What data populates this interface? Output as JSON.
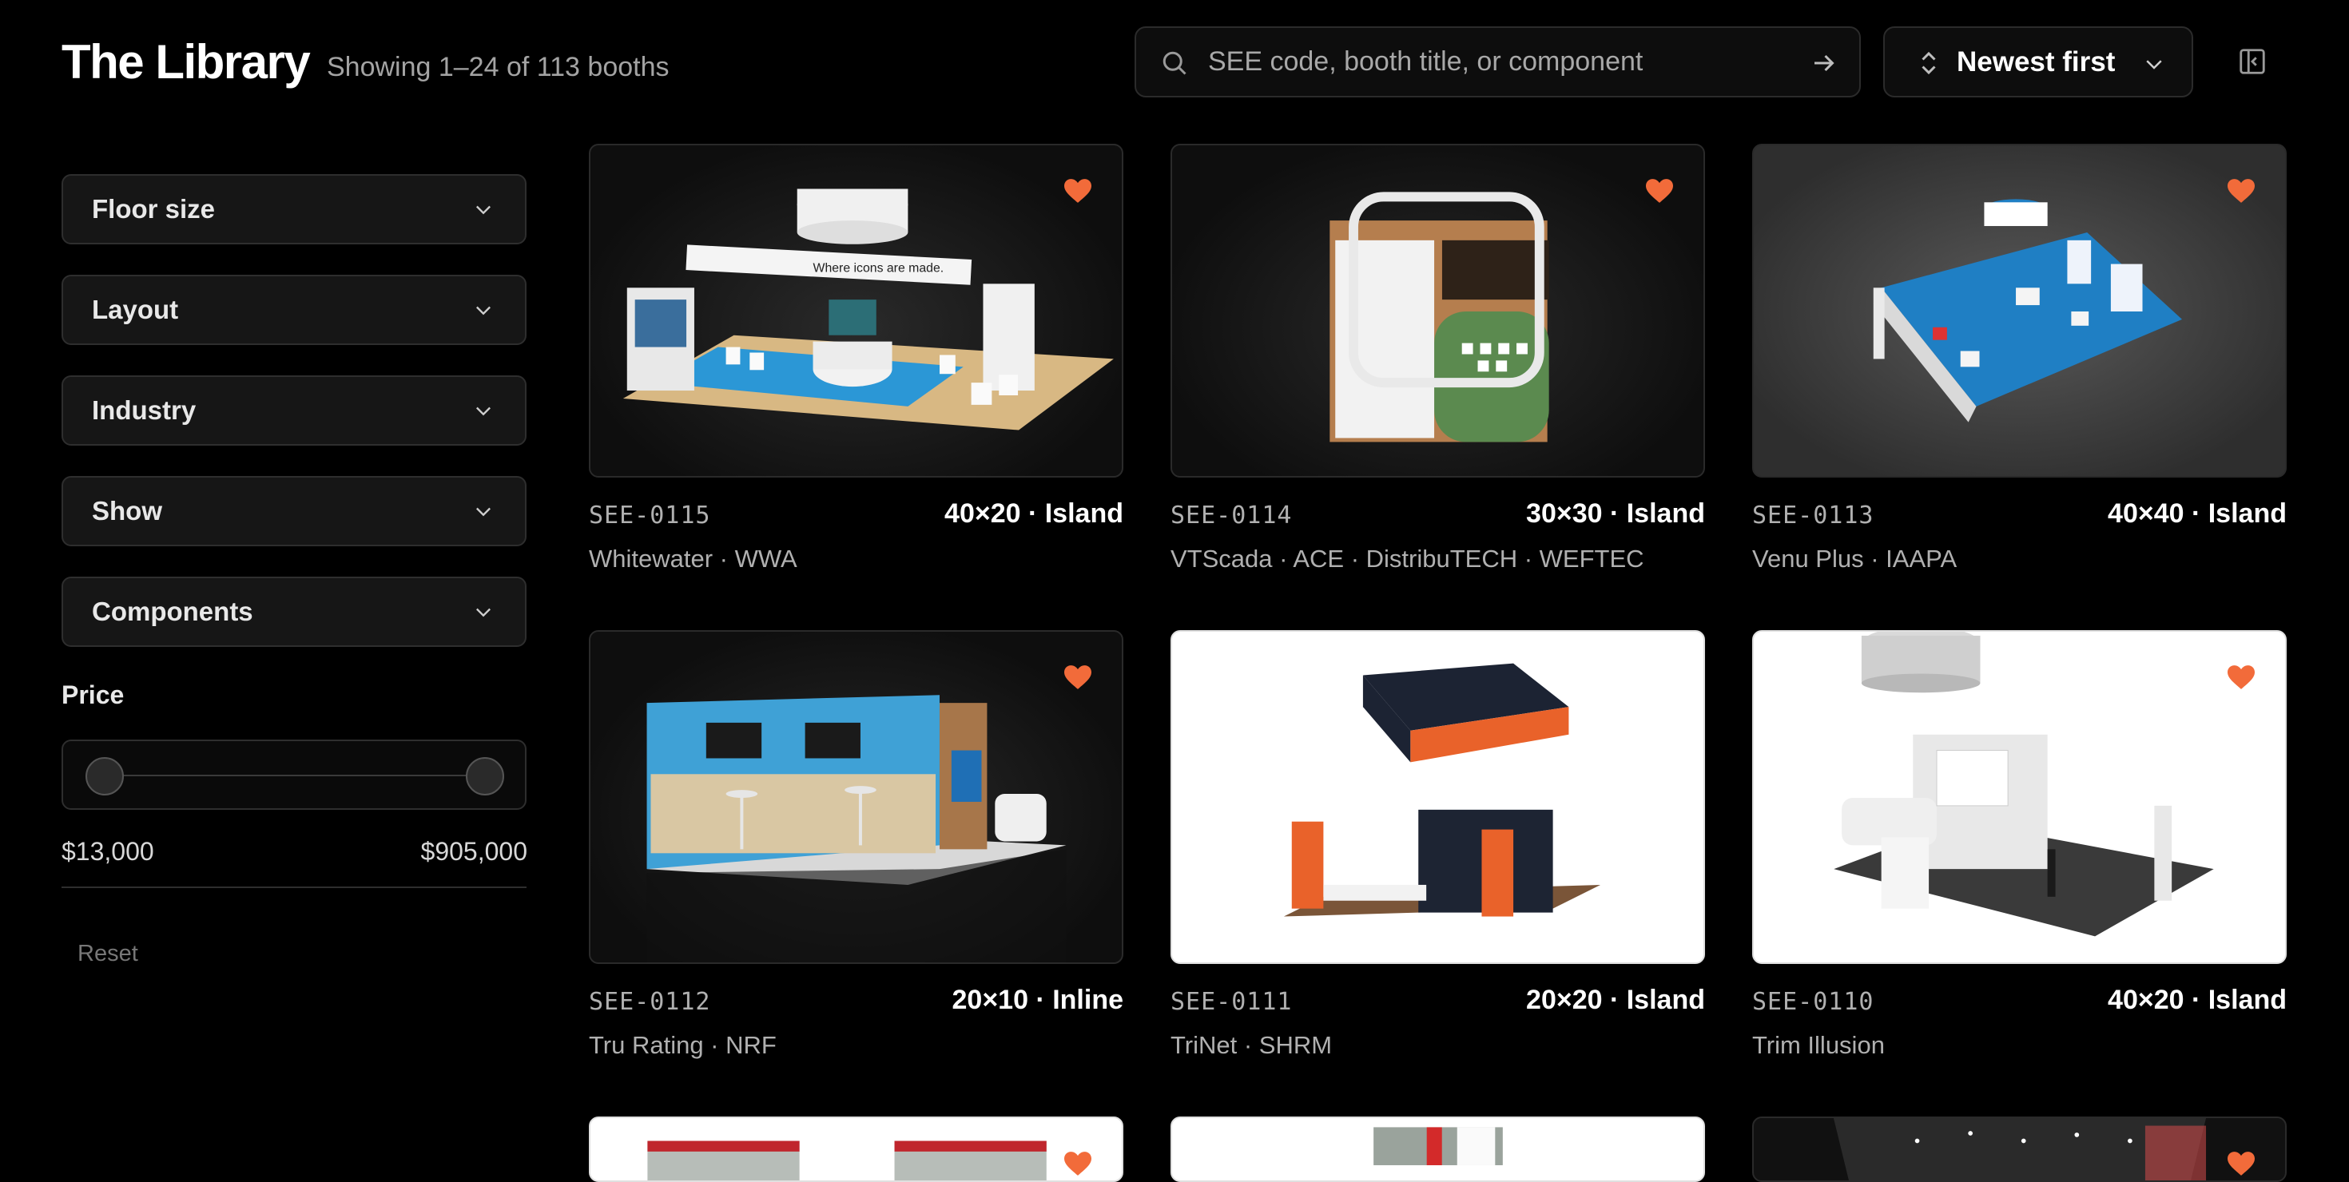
{
  "header": {
    "title": "The Library",
    "count": "Showing 1–24 of 113 booths"
  },
  "search": {
    "placeholder": "SEE code, booth title, or component"
  },
  "sort": {
    "label": "Newest first"
  },
  "filters": [
    {
      "label": "Floor size"
    },
    {
      "label": "Layout"
    },
    {
      "label": "Industry"
    },
    {
      "label": "Show"
    },
    {
      "label": "Components"
    }
  ],
  "price": {
    "label": "Price",
    "min": "$13,000",
    "max": "$905,000"
  },
  "reset_label": "Reset",
  "colors": {
    "favorite": "#f26b3a",
    "booth_blue": "#1f7fc4"
  },
  "booths": [
    {
      "code": "SEE-0115",
      "spec": "40×20 · Island",
      "meta": "Whitewater  ·  WWA",
      "banner_text": "Where icons are made."
    },
    {
      "code": "SEE-0114",
      "spec": "30×30 · Island",
      "meta": "VTScada  ·  ACE · DistribuTECH · WEFTEC"
    },
    {
      "code": "SEE-0113",
      "spec": "40×40 · Island",
      "meta": "Venu Plus  ·  IAAPA"
    },
    {
      "code": "SEE-0112",
      "spec": "20×10 · Inline",
      "meta": "Tru Rating  ·  NRF"
    },
    {
      "code": "SEE-0111",
      "spec": "20×20 · Island",
      "meta": "TriNet  ·  SHRM"
    },
    {
      "code": "SEE-0110",
      "spec": "40×20 · Island",
      "meta": "Trim Illusion"
    }
  ]
}
